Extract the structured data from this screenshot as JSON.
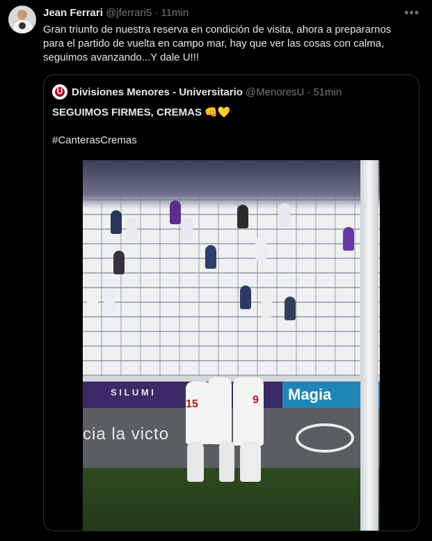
{
  "tweet": {
    "author_name": "Jean Ferrari",
    "author_handle": "@jferrari5",
    "time": "11min",
    "more_icon": "more-dots-icon",
    "lines": [
      "Gran triunfo de nuestra reserva en condición de visita, ahora a prepararnos",
      "para el partido de vuelta en campo mar, hay que ver las cosas con calma,",
      "seguimos avanzando...Y dale U!!!"
    ]
  },
  "quote": {
    "author_name": "Divisiones Menores - Universitario",
    "author_handle": "@MenoresU",
    "time": "51min",
    "logo_letter": "U",
    "line1": "SEGUIMOS FIRMES, CREMAS 👊💛",
    "hashtag": "#CanterasCremas",
    "photo": {
      "banner_text": "S I L U M I",
      "banner_text_right": "Magia",
      "ad_text": "cia la victo",
      "players": [
        {
          "number": "15"
        },
        {
          "number": "9"
        }
      ]
    }
  }
}
